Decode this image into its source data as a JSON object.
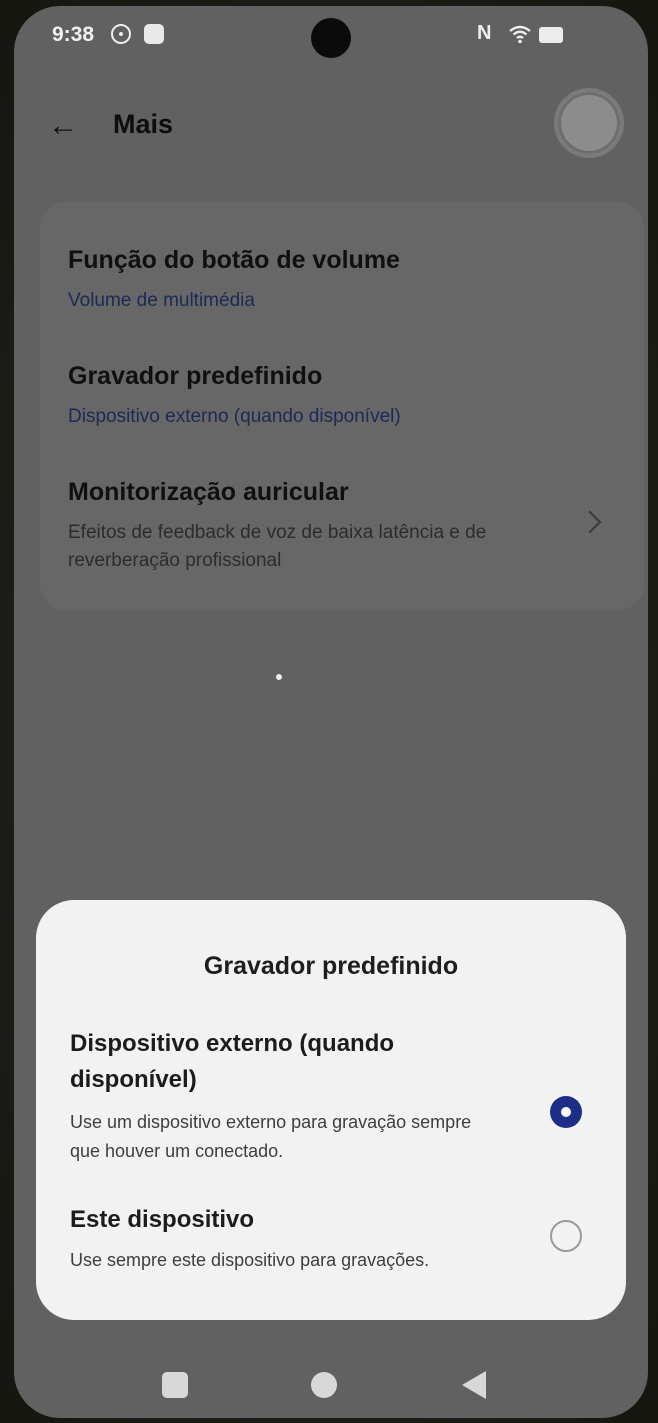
{
  "status_bar": {
    "time": "9:38",
    "nfc_label": "N",
    "icons": [
      "steering-wheel-icon",
      "app-notification-icon",
      "nfc-icon",
      "wifi-icon",
      "battery-icon"
    ]
  },
  "header": {
    "title": "Mais",
    "back_icon": "arrow-left-icon",
    "back_glyph": "←"
  },
  "settings": [
    {
      "title": "Função do botão de volume",
      "subtitle": "Volume de multimédia"
    },
    {
      "title": "Gravador predefinido",
      "subtitle": "Dispositivo externo (quando disponível)"
    },
    {
      "title": "Monitorização auricular",
      "subtitle": "Efeitos de feedback de voz de baixa latência e de reverberação profissional"
    }
  ],
  "dialog": {
    "title": "Gravador predefinido",
    "options": [
      {
        "title": "Dispositivo externo (quando disponível)",
        "description": "Use um dispositivo externo para gravação sempre que houver um conectado.",
        "selected": true
      },
      {
        "title": "Este dispositivo",
        "description": "Use sempre este dispositivo para gravações.",
        "selected": false
      }
    ]
  },
  "nav_bar": {
    "icons": [
      "recent-apps-icon",
      "home-icon",
      "back-triangle-icon"
    ]
  },
  "colors": {
    "accent": "#1e2d88",
    "dim_background": "#606160",
    "sheet": "#f2f2f2"
  }
}
